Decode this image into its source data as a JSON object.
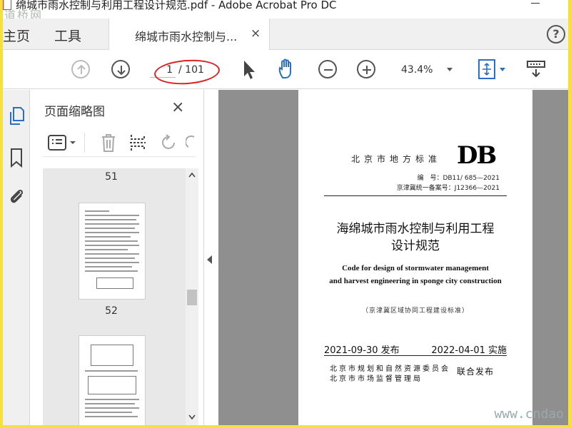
{
  "window": {
    "title": "绵城市雨水控制与利用工程设计规范.pdf - Adobe Acrobat Pro DC",
    "watermark_logo": "道桥网"
  },
  "tabs": {
    "home": "主页",
    "tools": "工具",
    "document": "绵城市雨水控制与...",
    "close_glyph": "×",
    "help_glyph": "?"
  },
  "toolbar": {
    "current_page": "1",
    "page_total": "/ 101",
    "zoom": "43.4%",
    "icons": [
      "arrow-up-circle-icon",
      "arrow-down-circle-icon",
      "select-pointer-icon",
      "hand-icon",
      "zoom-out-icon",
      "zoom-in-icon",
      "fit-page-icon",
      "read-mode-icon"
    ]
  },
  "thumbnail_panel": {
    "title": "页面缩略图",
    "close_glyph": "×",
    "page_numbers": [
      "51",
      "52"
    ]
  },
  "document": {
    "standard_type": "北京市地方标准",
    "logo": "DB",
    "code": "编　号：DB11/ 685—2021",
    "record": "京津冀统一备案号：J12366—2021",
    "title_line1": "海绵城市雨水控制与利用工程",
    "title_line2": "设计规范",
    "english_line1": "Code for design of stormwater management",
    "english_line2": "and harvest engineering in sponge city construction",
    "subtitle": "（京津冀区域协同工程建设标准）",
    "publish_date": "2021-09-30 发布",
    "effective_date": "2022-04-01 实施",
    "issuer1": "北京市规划和自然资源委员会",
    "issuer2": "北京市市场监督管理局",
    "joint_publish": "联合发布"
  },
  "site_watermark": "www.cndao"
}
